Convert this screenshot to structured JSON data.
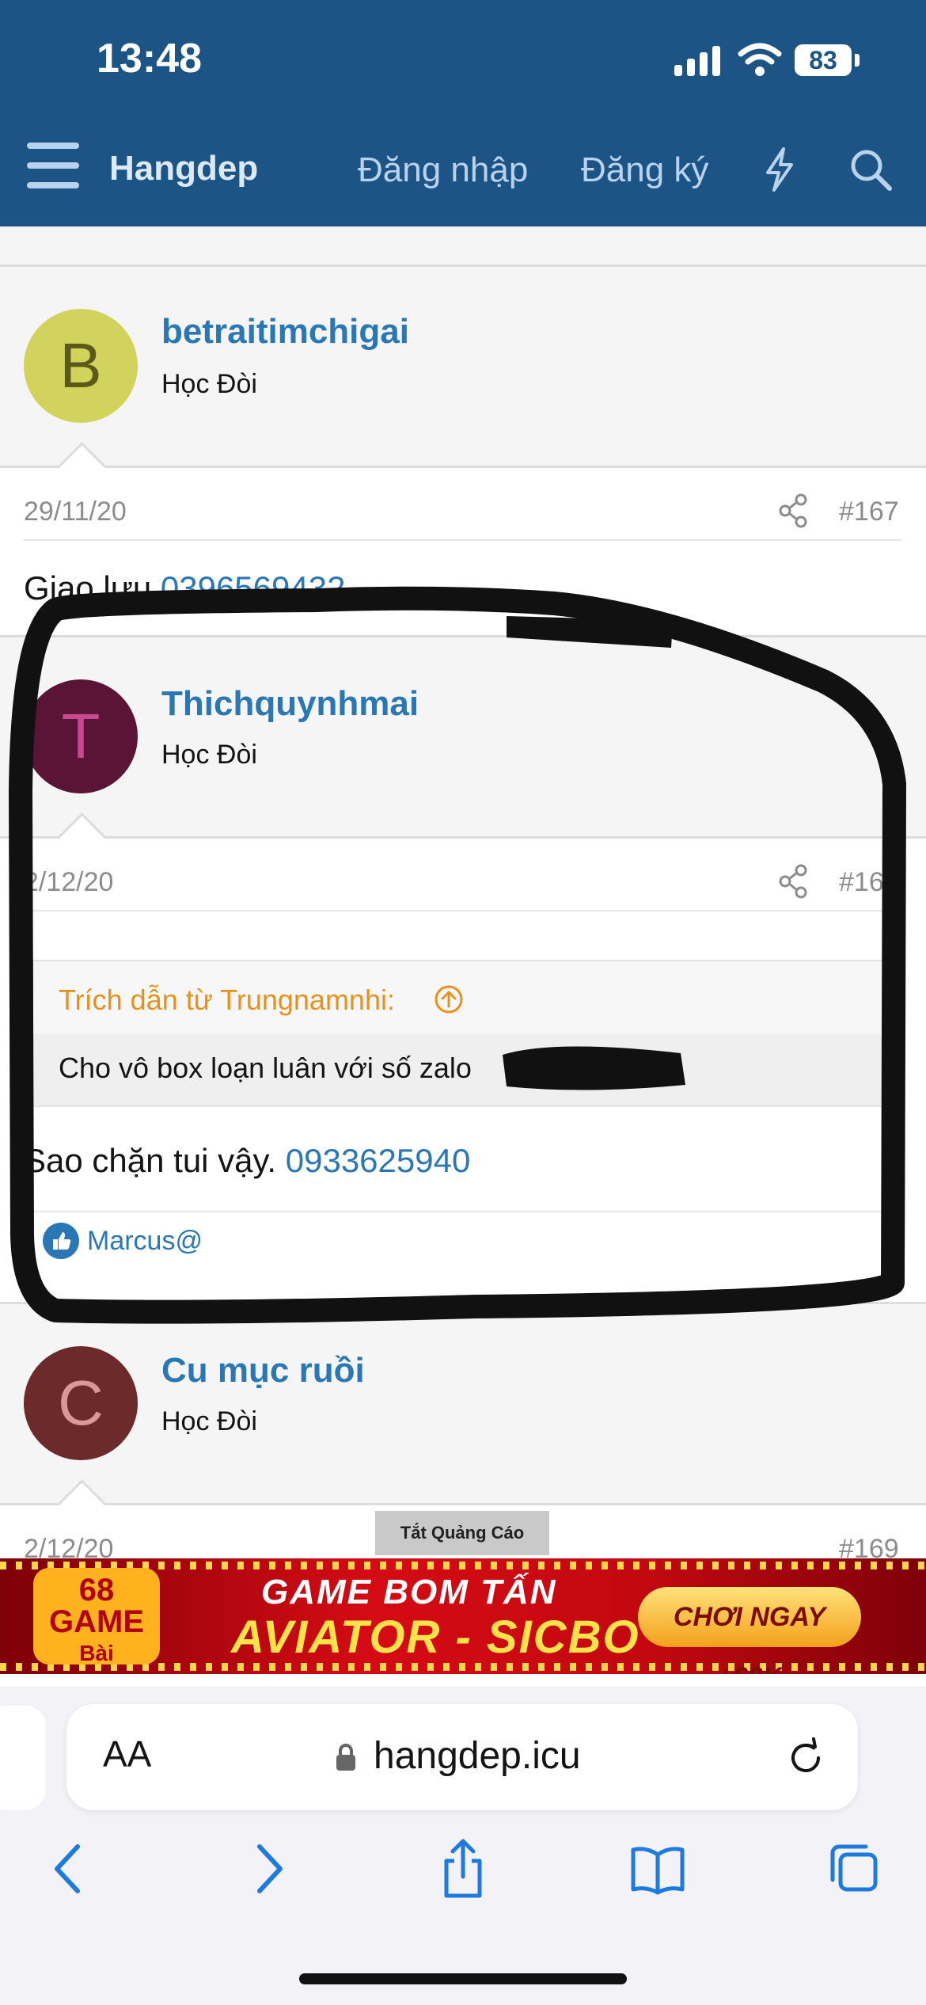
{
  "status_bar": {
    "time": "13:48",
    "battery": "83"
  },
  "nav": {
    "site_title": "Hangdep",
    "login": "Đăng nhập",
    "register": "Đăng ký",
    "icons": [
      "menu-icon",
      "bolt-icon",
      "search-icon"
    ]
  },
  "posts": [
    {
      "avatar_letter": "B",
      "avatar_color": "#d2d35d",
      "avatar_text_color": "#5b5a16",
      "username": "betraitimchigai",
      "role": "Học Đòi",
      "date": "29/11/20",
      "number": "#167",
      "body_text": "Giao lưu ",
      "body_phone": "0396569432"
    },
    {
      "avatar_letter": "T",
      "avatar_color": "#5a1435",
      "avatar_text_color": "#c8498f",
      "username": "Thichquynhmai",
      "role": "Học Đòi",
      "date": "2/12/20",
      "number": "#168",
      "quote_title": "Trích dẫn từ Trungnamnhi:",
      "quote_text": "Cho vô box loạn luân với số zalo",
      "body_text": "Sao chặn tui vậy. ",
      "body_phone": "0933625940",
      "reaction_user": "Marcus@"
    },
    {
      "avatar_letter": "C",
      "avatar_color": "#6d2a2a",
      "avatar_text_color": "#d99a96",
      "username": "Cu mục ruồi",
      "role": "Học Đòi",
      "date": "2/12/20",
      "number": "#169"
    }
  ],
  "ad": {
    "close_label": "Tắt Quảng Cáo",
    "logo_top": "68",
    "logo_mid": "GAME",
    "logo_bottom": "Bài",
    "headline": "GAME BOM TẤN",
    "subheadline": "AVIATOR - SICBO",
    "cta": "CHƠI NGAY +68K"
  },
  "browser": {
    "text_size_label": "AA",
    "url": "hangdep.icu",
    "toolbar_icons": [
      "back-icon",
      "forward-icon",
      "share-icon",
      "bookmarks-icon",
      "tabs-icon"
    ]
  },
  "colors": {
    "nav_bg": "#1c5486",
    "link": "#2a77b5",
    "quote_accent": "#f0a31e"
  }
}
